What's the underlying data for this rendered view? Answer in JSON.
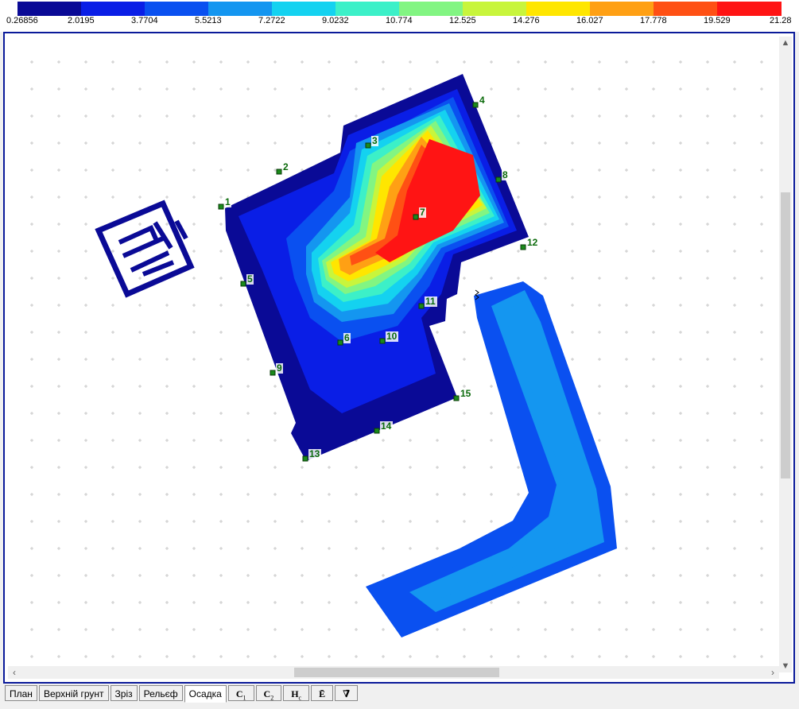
{
  "legend": {
    "ticks": [
      "0.26856",
      "2.0195",
      "3.7704",
      "5.5213",
      "7.2722",
      "9.0232",
      "10.774",
      "12.525",
      "14.276",
      "16.027",
      "17.778",
      "19.529",
      "21.28"
    ],
    "colors": [
      "#0a0a96",
      "#0a1ee6",
      "#0a50f0",
      "#1496f0",
      "#14d2f0",
      "#3cf0c8",
      "#82f582",
      "#c8f53c",
      "#ffe600",
      "#ffa014",
      "#ff5014",
      "#ff1414"
    ]
  },
  "map": {
    "points": [
      {
        "id": "1",
        "label": "1"
      },
      {
        "id": "2",
        "label": "2"
      },
      {
        "id": "3",
        "label": "3"
      },
      {
        "id": "4",
        "label": "4"
      },
      {
        "id": "5",
        "label": "5"
      },
      {
        "id": "6",
        "label": "6"
      },
      {
        "id": "7",
        "label": "7"
      },
      {
        "id": "8",
        "label": "8"
      },
      {
        "id": "9",
        "label": "9"
      },
      {
        "id": "10",
        "label": "10"
      },
      {
        "id": "11",
        "label": "11"
      },
      {
        "id": "12",
        "label": "12"
      },
      {
        "id": "13",
        "label": "13"
      },
      {
        "id": "14",
        "label": "14"
      },
      {
        "id": "15",
        "label": "15"
      }
    ],
    "point_color": "#1a8a1a",
    "label_color": "#0a6a0a"
  },
  "tabs": [
    {
      "label": "План"
    },
    {
      "label": "Верхній грунт"
    },
    {
      "label": "Зріз"
    },
    {
      "label": "Рельєф"
    },
    {
      "label": "Осадка",
      "active": true
    },
    {
      "label": "C",
      "sub": "1"
    },
    {
      "label": "C",
      "sub": "2"
    },
    {
      "label": "H",
      "sub": "c"
    },
    {
      "label": "Ē"
    },
    {
      "label": "∇̄"
    }
  ],
  "icons": {
    "scroll_up": "triangle-up-icon",
    "scroll_down": "triangle-down-icon",
    "scroll_left": "chevron-left-icon",
    "scroll_right": "chevron-right-icon"
  }
}
